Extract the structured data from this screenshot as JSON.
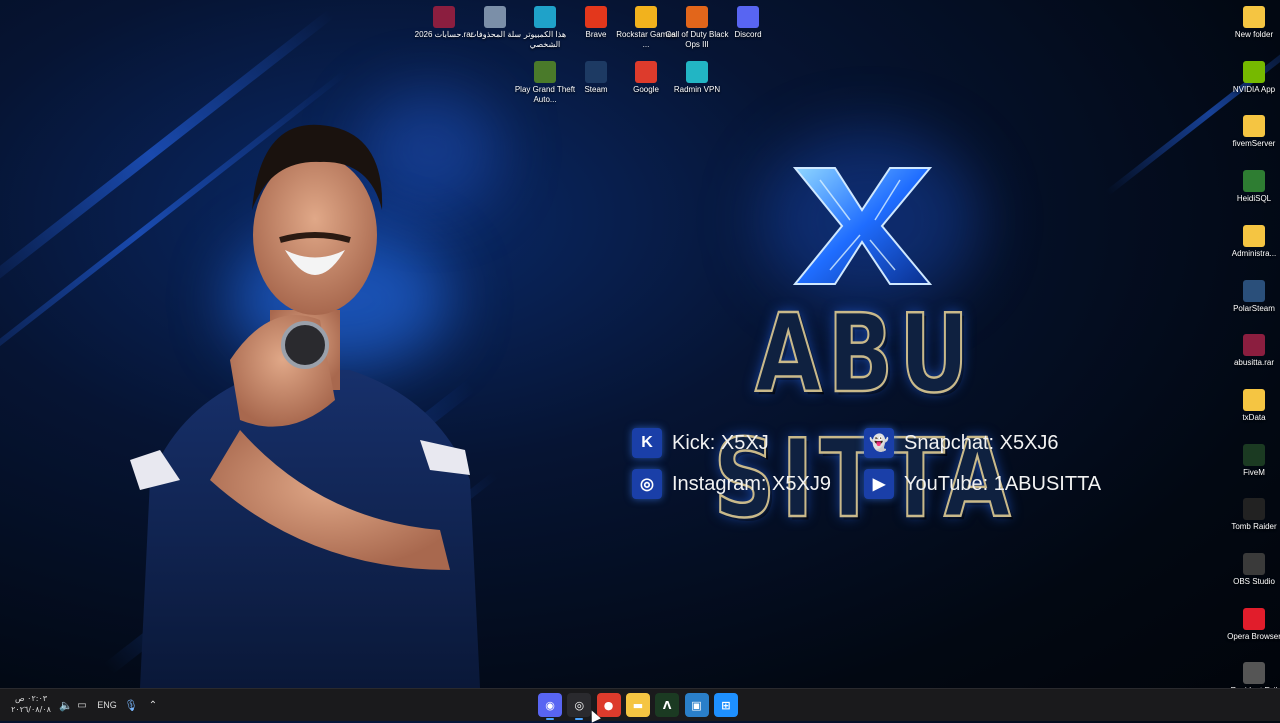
{
  "desktop_icons_top": [
    {
      "label": "حسابات 2026.rar",
      "icon": "winrar-archive-icon",
      "color": "#8b1e3f"
    },
    {
      "label": "سلة المحذوفات",
      "icon": "recycle-bin-icon",
      "color": "#7b8fa8"
    },
    {
      "label": "هذا الكمبيوتر الشخصي",
      "icon": "this-pc-icon",
      "color": "#1fa2c9"
    },
    {
      "label": "Brave",
      "icon": "brave-icon",
      "color": "#e3371c"
    },
    {
      "label": "Rockstar Games ...",
      "icon": "rockstar-icon",
      "color": "#f2b21d"
    },
    {
      "label": "Call of Duty Black Ops III",
      "icon": "cod-icon",
      "color": "#e2661b"
    },
    {
      "label": "Discord",
      "icon": "discord-icon",
      "color": "#5865f2"
    },
    {
      "label": "Play Grand Theft Auto...",
      "icon": "gta-icon",
      "color": "#4a7a2a"
    },
    {
      "label": "Steam",
      "icon": "steam-icon",
      "color": "#1d3a63"
    },
    {
      "label": "Google",
      "icon": "chrome-icon",
      "color": "#dd3b2c"
    },
    {
      "label": "Radmin VPN",
      "icon": "radmin-vpn-icon",
      "color": "#22b5c4"
    }
  ],
  "desktop_icons_right": [
    {
      "label": "New folder",
      "icon": "folder-icon",
      "color": "#f5c542"
    },
    {
      "label": "NVIDIA App",
      "icon": "nvidia-icon",
      "color": "#76b900"
    },
    {
      "label": "fivemServer",
      "icon": "folder-icon",
      "color": "#f5c542"
    },
    {
      "label": "HeidiSQL",
      "icon": "heidisql-icon",
      "color": "#2e7d32"
    },
    {
      "label": "Administra...",
      "icon": "folder-icon",
      "color": "#f5c542"
    },
    {
      "label": "PolarSteam",
      "icon": "polarsteam-icon",
      "color": "#2a4f7a"
    },
    {
      "label": "abusitta.rar",
      "icon": "winrar-archive-icon",
      "color": "#8b1e3f"
    },
    {
      "label": "txData",
      "icon": "folder-icon",
      "color": "#f5c542"
    },
    {
      "label": "FiveM",
      "icon": "fivem-icon",
      "color": "#1b3a22"
    },
    {
      "label": "Tomb Raider",
      "icon": "tomb-raider-icon",
      "color": "#222222"
    },
    {
      "label": "OBS Studio",
      "icon": "obs-icon",
      "color": "#3a3a3a"
    },
    {
      "label": "Opera Browser",
      "icon": "opera-icon",
      "color": "#e11d2b"
    },
    {
      "label": "Resident Evil",
      "icon": "game-icon",
      "color": "#555555"
    }
  ],
  "wallpaper": {
    "brand_letter": "X",
    "brand_name": "ABU SITTA",
    "socials": [
      {
        "label": "Kick: X5XJ",
        "icon": "kick-icon",
        "glyph": "K"
      },
      {
        "label": "Snapchat: X5XJ6",
        "icon": "snapchat-icon",
        "glyph": "👻"
      },
      {
        "label": "Instagram: X5XJ9",
        "icon": "instagram-icon",
        "glyph": "◎"
      },
      {
        "label": "YouTube: 1ABUSITTA",
        "icon": "youtube-icon",
        "glyph": "▶"
      }
    ],
    "accent": "#1a4fd6"
  },
  "taskbar": {
    "clock_time": "٠٢:٠٣ ص",
    "clock_date": "٢٠٢٦/٠٨/٠٨",
    "language": "ENG",
    "apps": [
      {
        "name": "discord-app",
        "glyph": "◉",
        "color": "#5865f2",
        "active": true
      },
      {
        "name": "steam-app",
        "glyph": "◎",
        "color": "#2a2a2e",
        "active": true
      },
      {
        "name": "chrome-app",
        "glyph": "●",
        "color": "#dd3b2c",
        "active": false
      },
      {
        "name": "file-explorer-app",
        "glyph": "▬",
        "color": "#f5c542",
        "active": false
      },
      {
        "name": "app-green",
        "glyph": "Λ",
        "color": "#1b3a22",
        "active": false
      },
      {
        "name": "photos-app",
        "glyph": "▣",
        "color": "#2a7fc9",
        "active": false
      },
      {
        "name": "start-app",
        "glyph": "⊞",
        "color": "#1e90ff",
        "active": false
      }
    ]
  }
}
